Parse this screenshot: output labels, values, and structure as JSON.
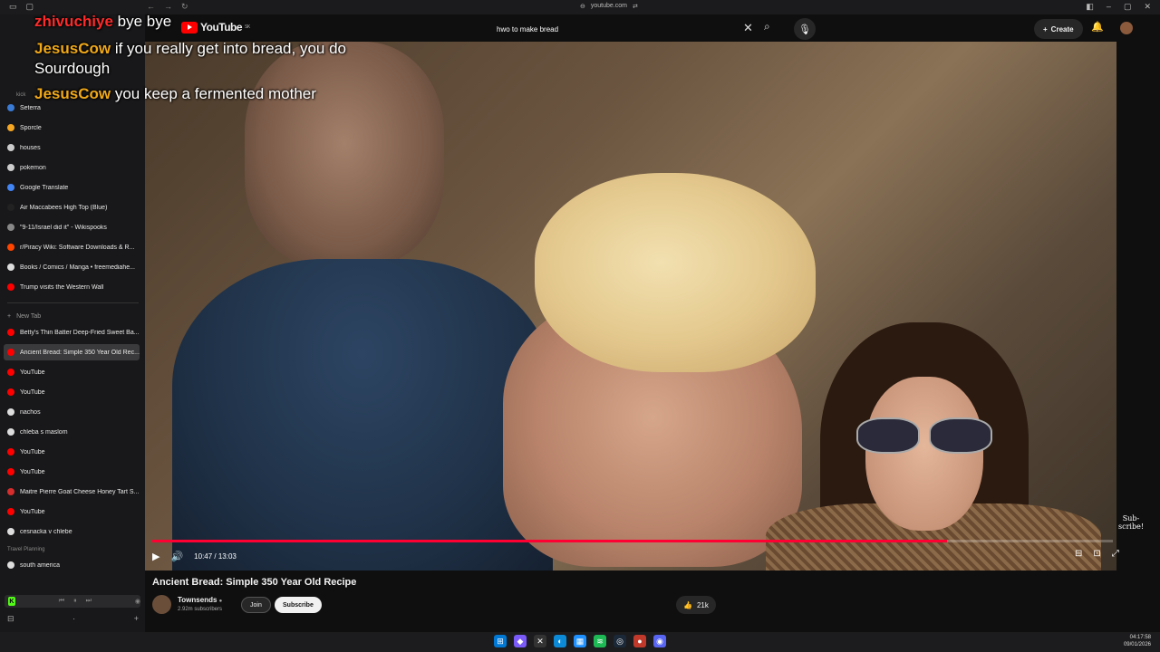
{
  "browser": {
    "url": "youtube.com"
  },
  "sidebar": {
    "items": [
      {
        "label": "Seterra",
        "color": "#3a7bd5"
      },
      {
        "label": "Sporcle",
        "color": "#f5a623"
      },
      {
        "label": "houses",
        "color": "#cccccc"
      },
      {
        "label": "pokemon",
        "color": "#cccccc"
      },
      {
        "label": "Google Translate",
        "color": "#4285f4"
      },
      {
        "label": "Air Maccabees High Top (Blue)",
        "color": "#222222"
      },
      {
        "label": "\"9-11/Israel did it\" - Wikispooks",
        "color": "#888888"
      },
      {
        "label": "r/Piracy Wiki: Software Downloads & R...",
        "color": "#ff4500"
      },
      {
        "label": "Books / Comics / Manga • freemediahe...",
        "color": "#dddddd"
      },
      {
        "label": "Trump visits the Western Wall",
        "color": "#ff0000"
      }
    ],
    "new_tab_label": "New Tab",
    "tabs": [
      {
        "label": "Betty's Thin Batter Deep-Fried Sweet Ba...",
        "color": "#ff0000",
        "active": false
      },
      {
        "label": "Ancient Bread: Simple 350 Year Old Rec...",
        "color": "#ff0000",
        "active": true
      },
      {
        "label": "YouTube",
        "color": "#ff0000",
        "active": false
      },
      {
        "label": "YouTube",
        "color": "#ff0000",
        "active": false
      },
      {
        "label": "nachos",
        "color": "#dddddd",
        "active": false
      },
      {
        "label": "chleba s maslom",
        "color": "#dddddd",
        "active": false
      },
      {
        "label": "YouTube",
        "color": "#ff0000",
        "active": false
      },
      {
        "label": "YouTube",
        "color": "#ff0000",
        "active": false
      },
      {
        "label": "Maitre Pierre Goat Cheese Honey Tart S...",
        "color": "#d62d2d",
        "active": false
      },
      {
        "label": "YouTube",
        "color": "#ff0000",
        "active": false
      },
      {
        "label": "cesnacka v chlebe",
        "color": "#dddddd",
        "active": false
      }
    ],
    "section_label": "Travel Planning",
    "section_items": [
      {
        "label": "south america",
        "color": "#dddddd"
      }
    ],
    "overlay_label": "kick"
  },
  "youtube": {
    "logo_text": "YouTube",
    "logo_region": "SK",
    "search_value": "hwo to make bread",
    "create_label": "Create"
  },
  "player": {
    "time": "10:47 / 13:03",
    "progress_fraction": 0.8275,
    "watermark": "Sub-\nscribe!"
  },
  "video": {
    "title": "Ancient Bread: Simple 350 Year Old Recipe",
    "channel": "Townsends",
    "subscribers": "2.92m subscribers",
    "join_label": "Join",
    "subscribe_label": "Subscribe",
    "likes": "21k"
  },
  "chat": [
    {
      "user": "zhivuchiye",
      "message": "bye bye",
      "color": "#ff2a2a"
    },
    {
      "user": "JesusCow",
      "message": "if you really get into bread, you do",
      "color": "#f0a818"
    },
    {
      "user": "",
      "message": "Sourdough",
      "color": ""
    },
    {
      "user": "JesusCow",
      "message": "you keep a fermented mother",
      "color": "#f0a818"
    }
  ],
  "taskbar": {
    "time": "04:17:58",
    "date": "09/01/2026"
  }
}
